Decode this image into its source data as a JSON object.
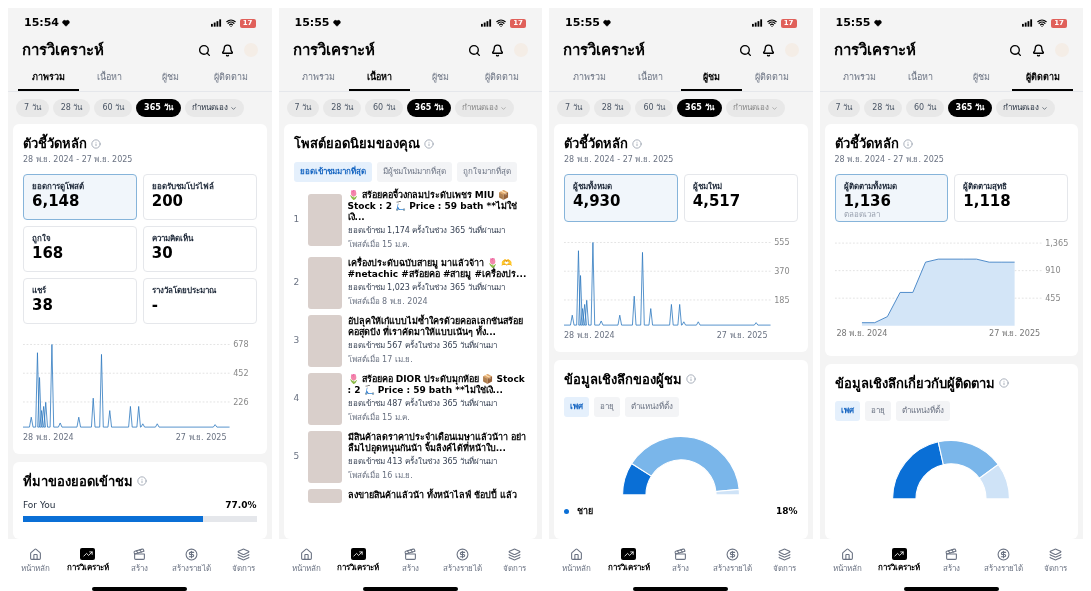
{
  "screens": [
    {
      "status": {
        "time": "15:54",
        "battery": "17"
      },
      "title": "การวิเคราะห์",
      "tabs": [
        {
          "label": "ภาพรวม",
          "selected": true
        },
        {
          "label": "เนื้อหา",
          "selected": false
        },
        {
          "label": "ผู้ชม",
          "selected": false
        },
        {
          "label": "ผู้ติดตาม",
          "selected": false
        }
      ],
      "periods": [
        {
          "label": "7 วัน",
          "selected": false
        },
        {
          "label": "28 วัน",
          "selected": false
        },
        {
          "label": "60 วัน",
          "selected": false
        },
        {
          "label": "365 วัน",
          "selected": true
        }
      ],
      "custom_period": {
        "label": "กำหนดเอง",
        "disabled": false
      },
      "sections": [
        {
          "kind": "metrics",
          "title": "ตัวชี้วัดหลัก",
          "date_range": "28 พ.ย. 2024 - 27 พ.ย. 2025",
          "cards": [
            {
              "label": "ยอดการดูโพสต์",
              "value": "6,148",
              "selected": true
            },
            {
              "label": "ยอดรับชมโปรไฟล์",
              "value": "200",
              "selected": false
            },
            {
              "label": "ถูกใจ",
              "value": "168",
              "selected": false
            },
            {
              "label": "ความคิดเห็น",
              "value": "30",
              "selected": false
            },
            {
              "label": "แชร์",
              "value": "38",
              "selected": false
            },
            {
              "label": "รางวัลโดยประมาณ",
              "value": "-",
              "selected": false
            }
          ],
          "chart": {
            "y_labels": [
              "678",
              "452",
              "226"
            ],
            "x_start": "28 พ.ย. 2024",
            "x_end": "27 พ.ย. 2025"
          }
        },
        {
          "kind": "sources",
          "title": "ที่มาของยอดเข้าชม",
          "rows": [
            {
              "label": "For You",
              "value": "77.0%",
              "level": 0.77
            }
          ]
        }
      ],
      "nav": [
        {
          "label": "หน้าหลัก",
          "selected": false
        },
        {
          "label": "การวิเคราะห์",
          "selected": true
        },
        {
          "label": "สร้าง",
          "selected": false
        },
        {
          "label": "สร้างรายได้",
          "selected": false
        },
        {
          "label": "จัดการ",
          "selected": false
        }
      ]
    },
    {
      "status": {
        "time": "15:55",
        "battery": "17"
      },
      "title": "การวิเคราะห์",
      "tabs": [
        {
          "label": "ภาพรวม",
          "selected": false
        },
        {
          "label": "เนื้อหา",
          "selected": true
        },
        {
          "label": "ผู้ชม",
          "selected": false
        },
        {
          "label": "ผู้ติดตาม",
          "selected": false
        }
      ],
      "periods": [
        {
          "label": "7 วัน",
          "selected": false
        },
        {
          "label": "28 วัน",
          "selected": false
        },
        {
          "label": "60 วัน",
          "selected": false
        },
        {
          "label": "365 วัน",
          "selected": true
        }
      ],
      "custom_period": {
        "label": "กำหนดเอง",
        "disabled": true
      },
      "sections": [
        {
          "kind": "posts",
          "title": "โพสต์ยอดนิยมของคุณ",
          "filters": [
            {
              "label": "ยอดเข้าชมมากที่สุด",
              "selected": true
            },
            {
              "label": "มีผู้ชมใหม่มากที่สุด",
              "selected": false
            },
            {
              "label": "ถูกใจมากที่สุด",
              "selected": false
            }
          ],
          "posts": [
            {
              "rank": "1",
              "caption": "🌷 สร้อยคอจี้วงกลมประดับเพชร MIU 📦 Stock : 2 🛴 Price : 59 bath **ไม่ใช่เงิ...",
              "views": "ยอดเข้าชม 1,174 ครั้งในช่วง 365 วันที่ผ่านมา",
              "posted": "โพสต์เมื่อ 15 ม.ค."
            },
            {
              "rank": "2",
              "caption": "เครื่องประดับฉบับสายมู มาแล้วจ้าา 🌷 🫶 #netachic #สร้อยคอ #สายมู #เครื่องปร...",
              "views": "ยอดเข้าชม 1,023 ครั้งในช่วง 365 วันที่ผ่านมา",
              "posted": "โพสต์เมื่อ 8 พ.ย. 2024"
            },
            {
              "rank": "3",
              "caption": "อัปลุคให้เก๋แบบไม่ซ้ำใครด้วยคอลเลกชันสร้อยคอสุดปัง ที่เราคัดมาให้แบบเน้นๆ ทั้ง...",
              "views": "ยอดเข้าชม 567 ครั้งในช่วง 365 วันที่ผ่านมา",
              "posted": "โพสต์เมื่อ 17 เม.ย."
            },
            {
              "rank": "4",
              "caption": "🌷 สร้อยคอ DIOR ประดับมุกห้อย 📦 Stock : 2 🛴 Price : 59 bath **ไม่ใช่เงิ...",
              "views": "ยอดเข้าชม 487 ครั้งในช่วง 365 วันที่ผ่านมา",
              "posted": "โพสต์เมื่อ 15 ม.ค."
            },
            {
              "rank": "5",
              "caption": "มีสินค้าลดราคาประจำเดือนเมษาแล้วน้าา อย่าลืมไปอุดหนุนกันน้า จิ้มลิงค์ได้ที่หน้าใบ...",
              "views": "ยอดเข้าชม 413 ครั้งในช่วง 365 วันที่ผ่านมา",
              "posted": "โพสต์เมื่อ 16 เม.ย."
            },
            {
              "caption": "ลงขายสินค้าแล้วน้า ทั้งหน้าไลฟ์ ช้อปปี้ แล้ว"
            }
          ]
        }
      ],
      "nav": [
        {
          "label": "หน้าหลัก",
          "selected": false
        },
        {
          "label": "การวิเคราะห์",
          "selected": true
        },
        {
          "label": "สร้าง",
          "selected": false
        },
        {
          "label": "สร้างรายได้",
          "selected": false
        },
        {
          "label": "จัดการ",
          "selected": false
        }
      ]
    },
    {
      "status": {
        "time": "15:55",
        "battery": "17"
      },
      "title": "การวิเคราะห์",
      "tabs": [
        {
          "label": "ภาพรวม",
          "selected": false
        },
        {
          "label": "เนื้อหา",
          "selected": false
        },
        {
          "label": "ผู้ชม",
          "selected": true
        },
        {
          "label": "ผู้ติดตาม",
          "selected": false
        }
      ],
      "periods": [
        {
          "label": "7 วัน",
          "selected": false
        },
        {
          "label": "28 วัน",
          "selected": false
        },
        {
          "label": "60 วัน",
          "selected": false
        },
        {
          "label": "365 วัน",
          "selected": true
        }
      ],
      "custom_period": {
        "label": "กำหนดเอง",
        "disabled": true
      },
      "sections": [
        {
          "kind": "metrics",
          "title": "ตัวชี้วัดหลัก",
          "date_range": "28 พ.ย. 2024 - 27 พ.ย. 2025",
          "cards": [
            {
              "label": "ผู้ชมทั้งหมด",
              "value": "4,930",
              "selected": true
            },
            {
              "label": "ผู้ชมใหม่",
              "value": "4,517",
              "selected": false
            }
          ],
          "chart": {
            "y_labels": [
              "555",
              "370",
              "185"
            ],
            "x_start": "28 พ.ย. 2024",
            "x_end": "27 พ.ย. 2025"
          }
        },
        {
          "kind": "insights",
          "title": "ข้อมูลเชิงลึกของผู้ชม",
          "filters": [
            {
              "label": "เพศ",
              "selected": true
            },
            {
              "label": "อายุ",
              "selected": false
            },
            {
              "label": "ตำแหน่งที่ตั้ง",
              "selected": false
            }
          ],
          "legend": [
            {
              "label": "ชาย",
              "value": "18%",
              "color": "#0a6fd6"
            }
          ]
        }
      ],
      "nav": [
        {
          "label": "หน้าหลัก",
          "selected": false
        },
        {
          "label": "การวิเคราะห์",
          "selected": true
        },
        {
          "label": "สร้าง",
          "selected": false
        },
        {
          "label": "สร้างรายได้",
          "selected": false
        },
        {
          "label": "จัดการ",
          "selected": false
        }
      ]
    },
    {
      "status": {
        "time": "15:55",
        "battery": "17"
      },
      "title": "การวิเคราะห์",
      "tabs": [
        {
          "label": "ภาพรวม",
          "selected": false
        },
        {
          "label": "เนื้อหา",
          "selected": false
        },
        {
          "label": "ผู้ชม",
          "selected": false
        },
        {
          "label": "ผู้ติดตาม",
          "selected": true
        }
      ],
      "periods": [
        {
          "label": "7 วัน",
          "selected": false
        },
        {
          "label": "28 วัน",
          "selected": false
        },
        {
          "label": "60 วัน",
          "selected": false
        },
        {
          "label": "365 วัน",
          "selected": true
        }
      ],
      "custom_period": {
        "label": "กำหนดเอง",
        "disabled": false
      },
      "sections": [
        {
          "kind": "metrics",
          "title": "ตัวชี้วัดหลัก",
          "date_range": "28 พ.ย. 2024 - 27 พ.ย. 2025",
          "cards": [
            {
              "label": "ผู้ติดตามทั้งหมด",
              "value": "1,136",
              "note": "ตลอดเวลา",
              "selected": true
            },
            {
              "label": "ผู้ติดตามสุทธิ",
              "value": "1,118",
              "selected": false
            }
          ],
          "chart_data": {
            "type": "area",
            "categories": [
              "28 พ.ย. 2024",
              null,
              null,
              null,
              null,
              null,
              null,
              null,
              null,
              null,
              null,
              null,
              "27 พ.ย. 2025"
            ],
            "series": [
              {
                "color": "#3d7fc4",
                "values": [
                  50,
                  50,
                  150,
                  550,
                  550,
                  1050,
                  1100,
                  1100,
                  1100,
                  1100,
                  1050,
                  1050,
                  1050
                ]
              }
            ],
            "ylim": [
              0,
              1365
            ],
            "yticks": [
              {
                "value": 1365,
                "label": "1,365"
              },
              {
                "value": 910,
                "label": "910"
              },
              {
                "value": 455,
                "label": "455"
              }
            ]
          }
        },
        {
          "kind": "insights",
          "title": "ข้อมูลเชิงลึกเกี่ยวกับผู้ติดตาม",
          "filters": [
            {
              "label": "เพศ",
              "selected": true
            },
            {
              "label": "อายุ",
              "selected": false
            },
            {
              "label": "ตำแหน่งที่ตั้ง",
              "selected": false
            }
          ]
        }
      ],
      "nav": [
        {
          "label": "หน้าหลัก",
          "selected": false
        },
        {
          "label": "การวิเคราะห์",
          "selected": true
        },
        {
          "label": "สร้าง",
          "selected": false
        },
        {
          "label": "สร้างรายได้",
          "selected": false
        },
        {
          "label": "จัดการ",
          "selected": false
        }
      ]
    }
  ]
}
